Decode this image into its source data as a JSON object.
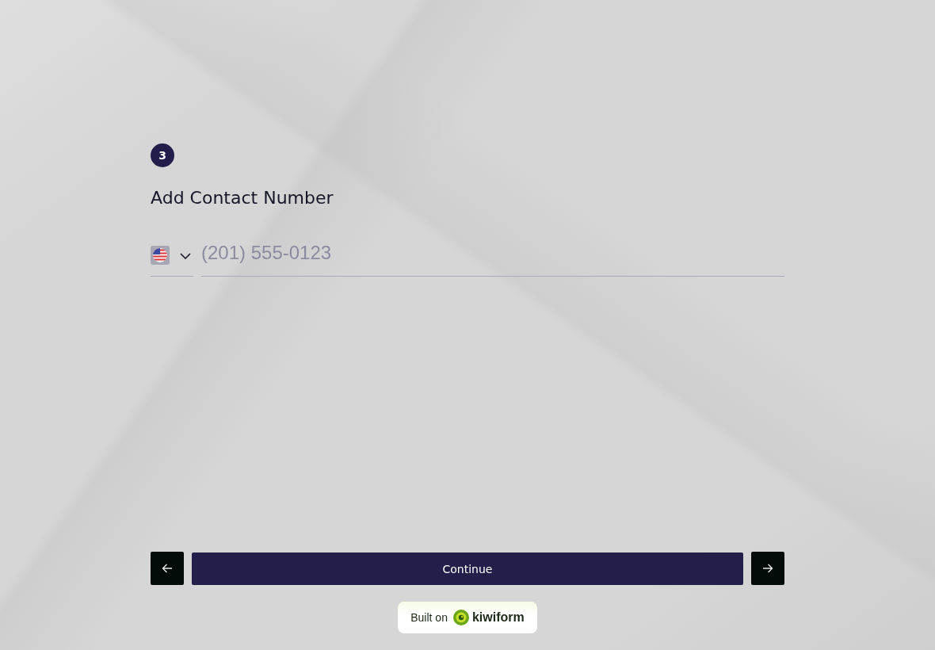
{
  "step": {
    "number": "3"
  },
  "question": {
    "title": "Add Contact Number"
  },
  "phone_field": {
    "placeholder": "(201) 555-0123"
  },
  "navigation": {
    "continue_label": "Continue"
  },
  "branding": {
    "prefix": "Built on",
    "brand": "kiwiform"
  }
}
